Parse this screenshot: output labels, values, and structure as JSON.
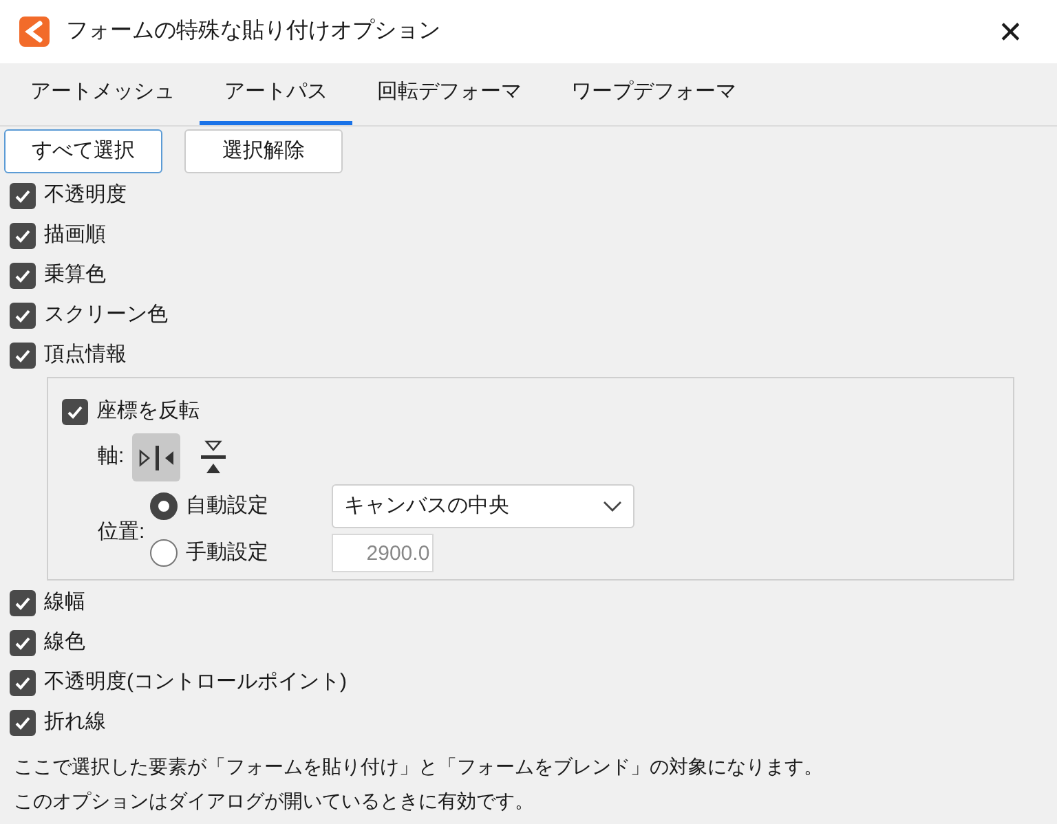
{
  "window": {
    "title": "フォームの特殊な貼り付けオプション",
    "close": "✕"
  },
  "tabs": [
    {
      "label": "アートメッシュ",
      "selected": false
    },
    {
      "label": "アートパス",
      "selected": true
    },
    {
      "label": "回転デフォーマ",
      "selected": false
    },
    {
      "label": "ワープデフォーマ",
      "selected": false
    }
  ],
  "buttons": [
    {
      "label": "すべて選択",
      "focused": true
    },
    {
      "label": "選択解除",
      "focused": false
    }
  ],
  "options_top": [
    {
      "label": "不透明度",
      "checked": true
    },
    {
      "label": "描画順",
      "checked": true
    },
    {
      "label": "乗算色",
      "checked": true
    },
    {
      "label": "スクリーン色",
      "checked": true
    },
    {
      "label": "頂点情報",
      "checked": true
    }
  ],
  "vertex_group": {
    "flip": {
      "label": "座標を反転",
      "checked": true
    },
    "axis_label": "軸:",
    "axes": [
      {
        "kind": "horizontal",
        "selected": true
      },
      {
        "kind": "vertical",
        "selected": false
      }
    ],
    "position_label": "位置:",
    "positions": [
      {
        "label": "自動設定",
        "selected": true
      },
      {
        "label": "手動設定",
        "selected": false
      }
    ],
    "dropdown": {
      "value": "キャンバスの中央"
    },
    "manual_value": {
      "value": "2900.0",
      "disabled": true
    }
  },
  "options_bottom": [
    {
      "label": "線幅",
      "checked": true
    },
    {
      "label": "線色",
      "checked": true
    },
    {
      "label": "不透明度(コントロールポイント)",
      "checked": true
    },
    {
      "label": "折れ線",
      "checked": true
    }
  ],
  "notes": [
    "ここで選択した要素が「フォームを貼り付け」と「フォームをブレンド」の対象になります。",
    "このオプションはダイアログが開いているときに有効です。"
  ]
}
